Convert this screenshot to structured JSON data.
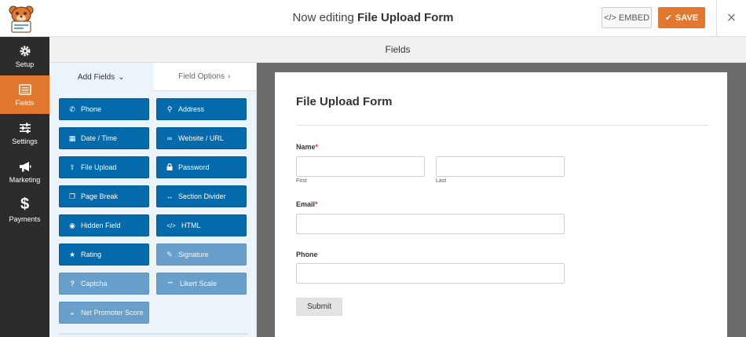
{
  "header": {
    "editing_prefix": "Now editing",
    "form_name": "File Upload Form",
    "embed_label": "EMBED",
    "save_label": "SAVE",
    "close_symbol": "×"
  },
  "sidebar": {
    "items": [
      {
        "label": "Setup",
        "icon": "gear-icon"
      },
      {
        "label": "Fields",
        "icon": "list-icon",
        "active": true
      },
      {
        "label": "Settings",
        "icon": "sliders-icon"
      },
      {
        "label": "Marketing",
        "icon": "megaphone-icon"
      },
      {
        "label": "Payments",
        "icon": "dollar-icon",
        "glyph": "$"
      }
    ]
  },
  "fields_bar": {
    "title": "Fields"
  },
  "panel": {
    "tabs": [
      {
        "label": "Add Fields",
        "chevron": "⌄"
      },
      {
        "label": "Field Options",
        "chevron": "›"
      }
    ],
    "buttons": [
      {
        "label": "Phone",
        "icon": "phone-icon",
        "glyph": "✆"
      },
      {
        "label": "Address",
        "icon": "map-pin-icon",
        "glyph": "⚲"
      },
      {
        "label": "Date / Time",
        "icon": "calendar-icon",
        "glyph": "▦"
      },
      {
        "label": "Website / URL",
        "icon": "link-icon",
        "glyph": "∞"
      },
      {
        "label": "File Upload",
        "icon": "upload-icon",
        "glyph": "⇪"
      },
      {
        "label": "Password",
        "icon": "lock-icon",
        "glyph": "🔒"
      },
      {
        "label": "Page Break",
        "icon": "copy-icon",
        "glyph": "❐"
      },
      {
        "label": "Section Divider",
        "icon": "arrows-h-icon",
        "glyph": "↔"
      },
      {
        "label": "Hidden Field",
        "icon": "eye-slash-icon",
        "glyph": "◉"
      },
      {
        "label": "HTML",
        "icon": "code-icon",
        "glyph": "</>"
      },
      {
        "label": "Rating",
        "icon": "star-icon",
        "glyph": "★"
      },
      {
        "label": "Signature",
        "icon": "pencil-icon",
        "glyph": "✎"
      },
      {
        "label": "Captcha",
        "icon": "question-circle-icon",
        "glyph": "?"
      },
      {
        "label": "Likert Scale",
        "icon": "ellipsis-icon",
        "glyph": "•••"
      },
      {
        "label": "Net Promoter Score",
        "icon": "gauge-icon",
        "glyph": "◒"
      }
    ]
  },
  "form": {
    "title": "File Upload Form",
    "name_label": "Name",
    "first_sublabel": "First",
    "last_sublabel": "Last",
    "email_label": "Email",
    "phone_label": "Phone",
    "required_mark": "*",
    "submit_label": "Submit"
  }
}
